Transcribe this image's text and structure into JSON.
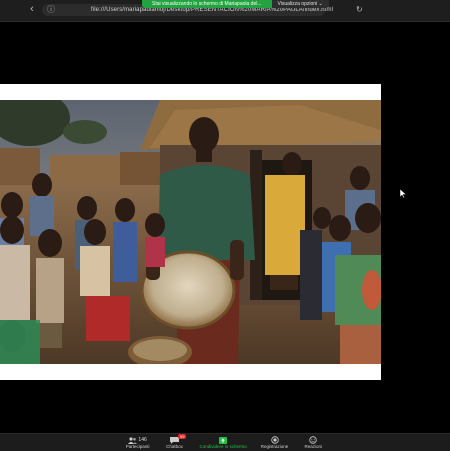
{
  "browser": {
    "url": "file:///Users/mariapaulamoj/Desktop/PRESENTACION%20MARIA%20PAULA/index.html",
    "share_banner": "Stai visualizzando lo schermo di Mariapaola del...",
    "share_options": "Visualizza opzioni ⌄"
  },
  "toolbar": {
    "participants_label": "Partecipanti",
    "participants_count": "146",
    "chat_label": "Chatbox",
    "chat_badge": "99",
    "share_label": "Condividere lo schermo",
    "record_label": "Registrazione",
    "reactions_label": "Reazioni"
  },
  "colors": {
    "share_green": "#23a33f",
    "toolbar_bg": "#1c1c1c",
    "badge_red": "#e02828"
  },
  "icons": [
    "back-arrow-icon",
    "file-icon",
    "reload-icon",
    "participants-icon",
    "chat-icon",
    "share-screen-icon",
    "record-icon",
    "reactions-icon",
    "mouse-cursor-icon"
  ]
}
